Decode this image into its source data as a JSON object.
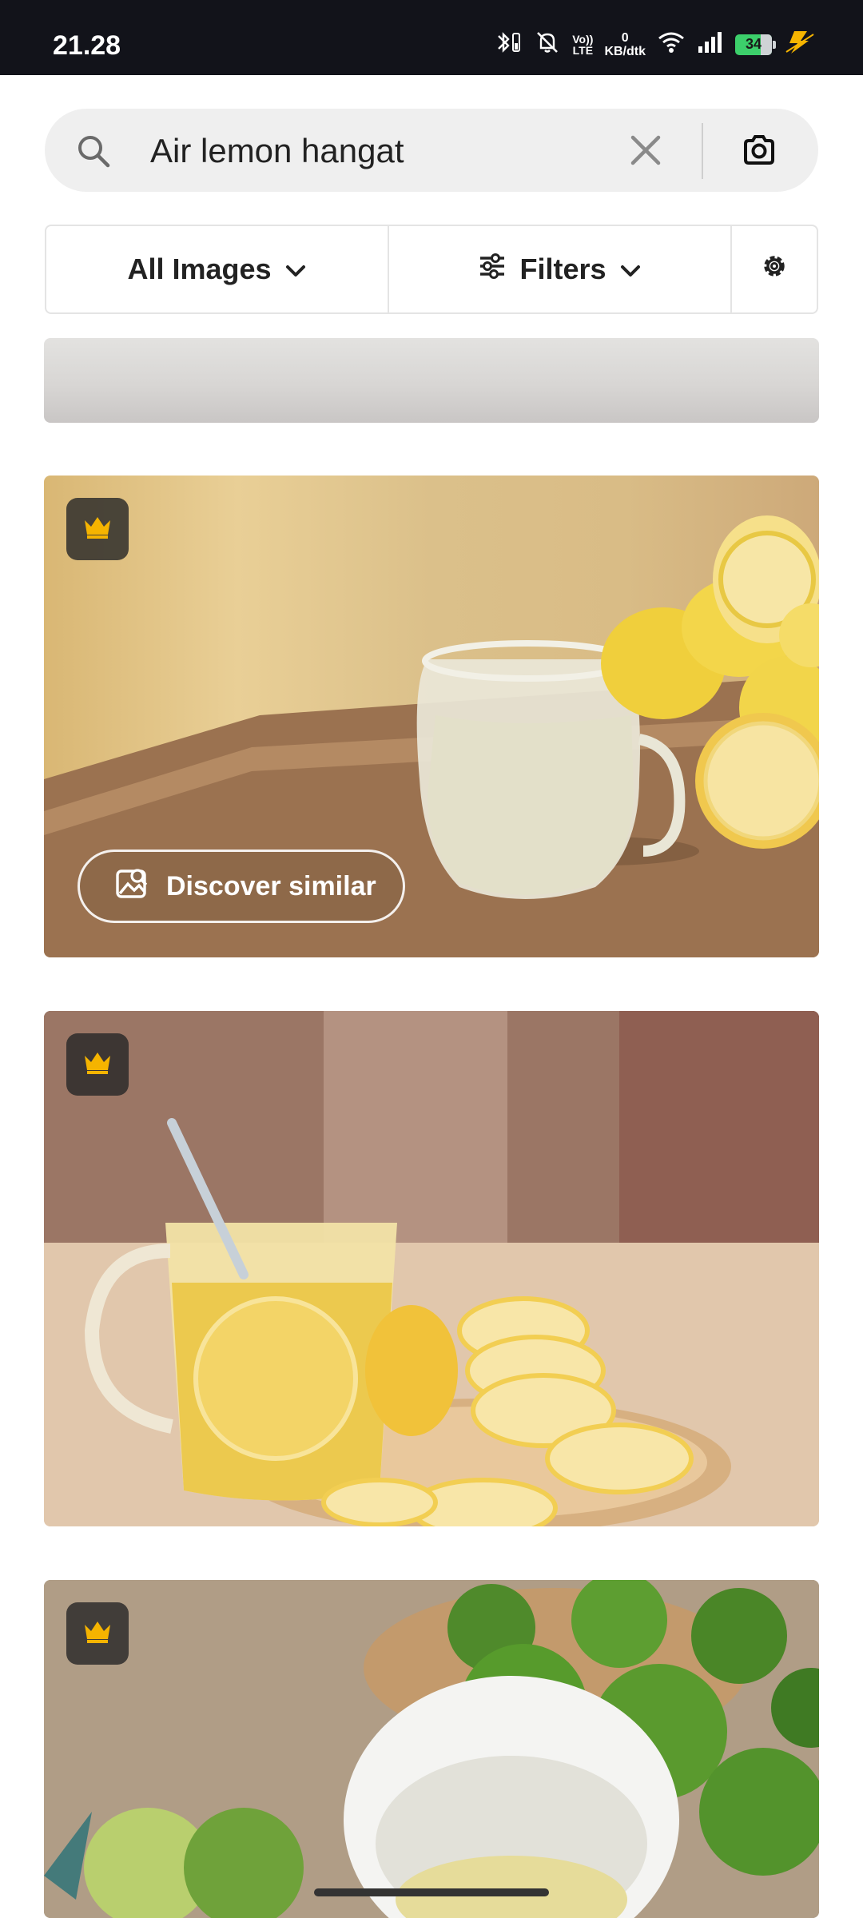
{
  "status_bar": {
    "time": "21.28",
    "net_speed_value": "0",
    "net_speed_unit": "KB/dtk",
    "volte_top": "Vo))",
    "volte_bottom": "LTE",
    "battery_level": "34"
  },
  "search": {
    "query": "Air lemon hangat",
    "icons": [
      "search-icon",
      "close-icon",
      "camera-icon"
    ]
  },
  "filter_bar": {
    "all_images_label": "All Images",
    "filters_label": "Filters",
    "icons": [
      "chevron-down-icon",
      "sliders-icon",
      "gear-icon"
    ]
  },
  "results": {
    "discover_label": "Discover similar",
    "premium_icon": "crown-icon",
    "accent_color": "#f5b400",
    "images": [
      {
        "subject": "partial image"
      },
      {
        "subject": "glass pitcher of lemon juice with lemons on wooden board"
      },
      {
        "subject": "glass mug of warm lemon water with spoon and lemon slices"
      },
      {
        "subject": "bowl of lime juice with green limes"
      }
    ]
  }
}
